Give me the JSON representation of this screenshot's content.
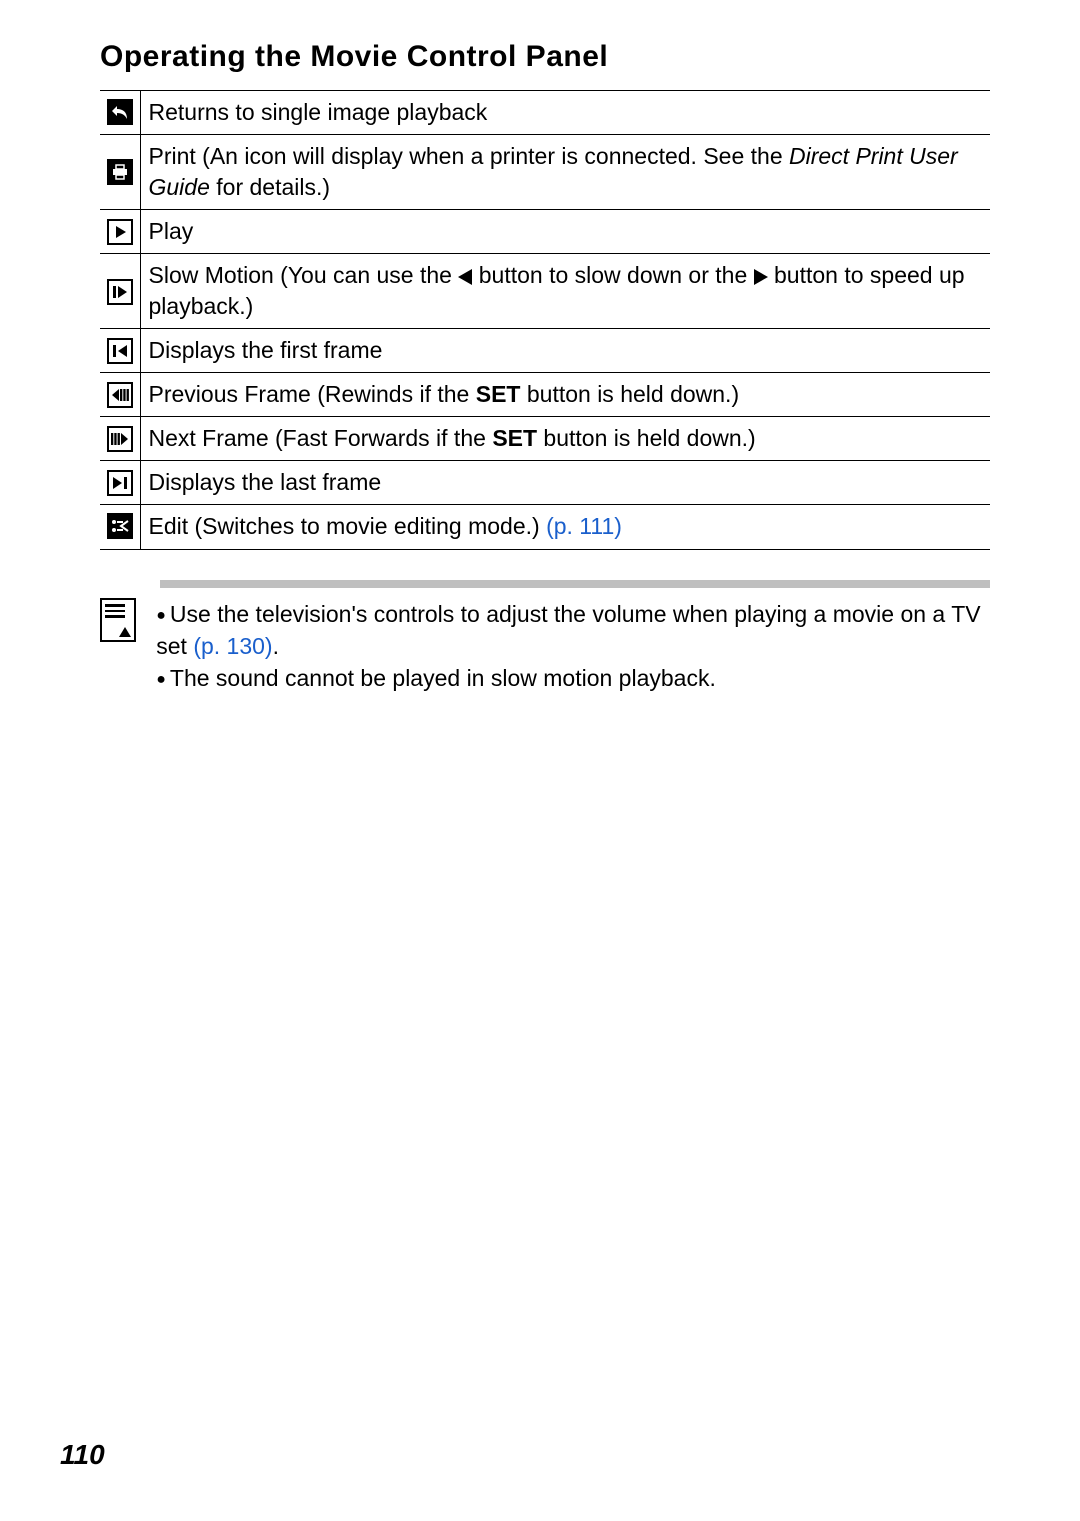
{
  "title": "Operating the Movie Control Panel",
  "rows": [
    {
      "icon": "return-icon",
      "text_plain": "Returns to single image playback"
    },
    {
      "icon": "print-icon",
      "text_print_a": "Print (An icon will display when a printer is connected. See the ",
      "text_print_italic": "Direct Print User Guide",
      "text_print_b": " for details.)"
    },
    {
      "icon": "play-icon",
      "text_plain": "Play"
    },
    {
      "icon": "slow-motion-icon",
      "text_slow_a": "Slow Motion (You can use the ",
      "text_slow_b": " button to slow down or the ",
      "text_slow_c": " button to speed up playback.)"
    },
    {
      "icon": "first-frame-icon",
      "text_plain": "Displays the first frame"
    },
    {
      "icon": "prev-frame-icon",
      "text_set_a": "Previous Frame (Rewinds if the ",
      "text_set_bold": "SET",
      "text_set_b": " button is held down.)"
    },
    {
      "icon": "next-frame-icon",
      "text_set_a": "Next Frame (Fast Forwards if the ",
      "text_set_bold": "SET",
      "text_set_b": " button is held down.)"
    },
    {
      "icon": "last-frame-icon",
      "text_plain": "Displays the last frame"
    },
    {
      "icon": "edit-icon",
      "text_edit_a": "Edit (Switches to movie editing mode.) ",
      "text_edit_link": "(p. 111)"
    }
  ],
  "notes": {
    "n1a": "Use the television's controls to adjust the volume when playing a movie on a TV set ",
    "n1link": "(p. 130)",
    "n1b": ".",
    "n2": "The sound cannot be played in slow motion playback."
  },
  "page_number": "110"
}
